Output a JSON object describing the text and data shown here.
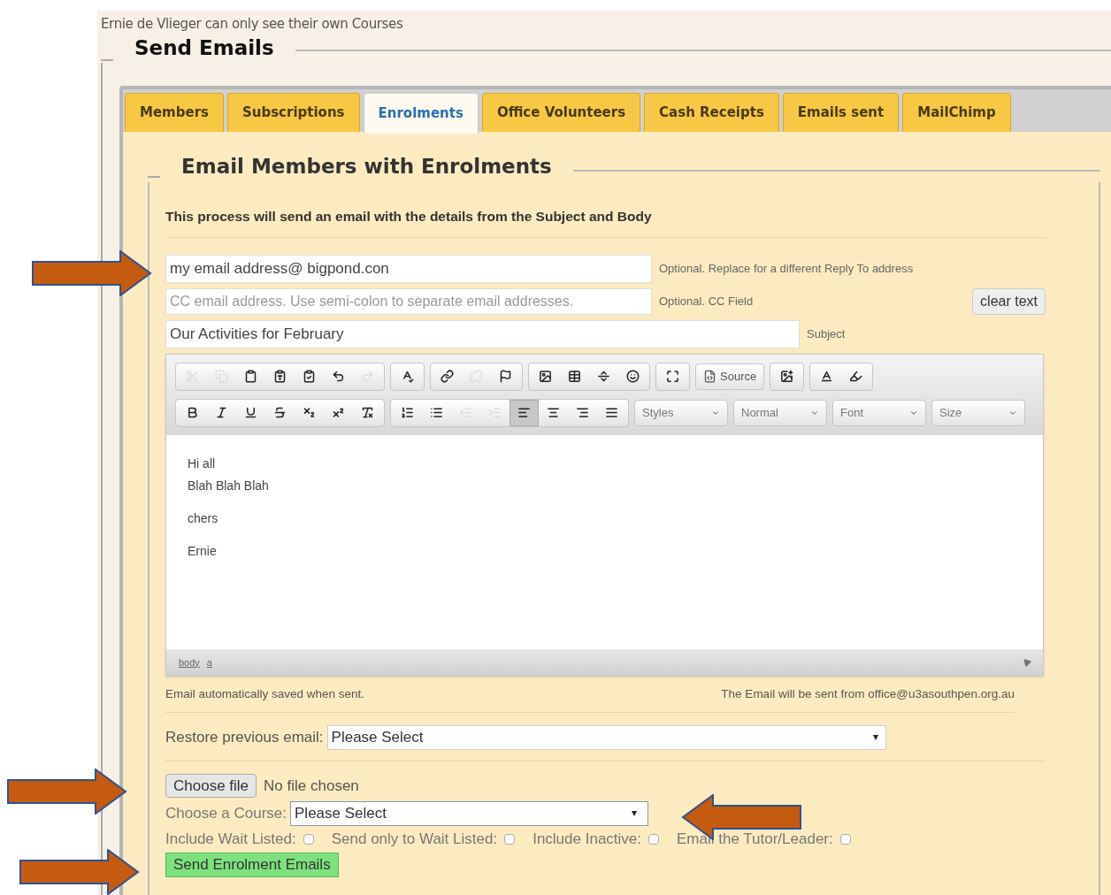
{
  "header": {
    "notice": "Ernie de Vlieger can only see their own Courses",
    "title": "Send Emails"
  },
  "tabs": [
    {
      "label": "Members",
      "selected": false
    },
    {
      "label": "Subscriptions",
      "selected": false
    },
    {
      "label": "Enrolments",
      "selected": true
    },
    {
      "label": "Office Volunteers",
      "selected": false
    },
    {
      "label": "Cash Receipts",
      "selected": false
    },
    {
      "label": "Emails sent",
      "selected": false
    },
    {
      "label": "MailChimp",
      "selected": false
    }
  ],
  "section": {
    "title": "Email Members with Enrolments",
    "intro": "This process will send an email with the details from the Subject and Body"
  },
  "reply_to": {
    "value": "my email address@ bigpond.con",
    "hint": "Optional. Replace for a different Reply To address"
  },
  "cc": {
    "placeholder": "CC email address. Use semi-colon to separate email addresses.",
    "hint": "Optional. CC Field",
    "clear_button": "clear text"
  },
  "subject": {
    "value": "Our Activities for February",
    "hint": "Subject"
  },
  "editor": {
    "toolbar_row_1": [
      [
        {
          "kind": "icon",
          "disabled": true
        },
        {
          "kind": "icon",
          "disabled": true
        },
        {
          "kind": "icon",
          "disabled": false
        },
        {
          "kind": "icon",
          "disabled": false
        },
        {
          "kind": "icon",
          "disabled": false
        },
        {
          "kind": "icon",
          "disabled": false
        },
        {
          "kind": "icon",
          "disabled": true
        }
      ],
      [
        {
          "kind": "icon",
          "disabled": false
        }
      ],
      [
        {
          "kind": "icon",
          "disabled": false
        },
        {
          "kind": "icon",
          "disabled": true
        },
        {
          "kind": "icon",
          "disabled": false
        }
      ],
      [
        {
          "kind": "icon",
          "disabled": false
        },
        {
          "kind": "icon",
          "disabled": false
        },
        {
          "kind": "icon",
          "disabled": false
        },
        {
          "kind": "icon",
          "disabled": false
        }
      ],
      [
        {
          "kind": "icon",
          "disabled": false
        }
      ],
      [
        {
          "kind": "text",
          "label": "Source"
        }
      ],
      [
        {
          "kind": "icon",
          "disabled": false
        }
      ],
      [
        {
          "kind": "icon",
          "disabled": false
        },
        {
          "kind": "icon",
          "disabled": false
        }
      ]
    ],
    "toolbar_row_2": [
      [
        {
          "kind": "icon",
          "disabled": false
        },
        {
          "kind": "icon",
          "disabled": false
        },
        {
          "kind": "icon",
          "disabled": false
        },
        {
          "kind": "icon",
          "disabled": false
        },
        {
          "kind": "icon",
          "disabled": false
        },
        {
          "kind": "icon",
          "disabled": false
        },
        {
          "kind": "icon",
          "disabled": false
        }
      ],
      [
        {
          "kind": "icon",
          "disabled": false
        },
        {
          "kind": "icon",
          "disabled": false
        },
        {
          "kind": "icon",
          "disabled": true
        },
        {
          "kind": "icon",
          "disabled": true
        },
        {
          "kind": "icon",
          "disabled": false,
          "selected": true
        },
        {
          "kind": "icon",
          "disabled": false,
          "selected": false
        },
        {
          "kind": "icon",
          "disabled": false,
          "selected": false
        },
        {
          "kind": "icon",
          "disabled": false,
          "selected": false
        }
      ],
      [
        {
          "kind": "dropdown",
          "label": "Styles"
        }
      ],
      [
        {
          "kind": "dropdown",
          "label": "Normal"
        }
      ],
      [
        {
          "kind": "dropdown",
          "label": "Font"
        }
      ],
      [
        {
          "kind": "dropdown",
          "label": "Size"
        }
      ]
    ],
    "body": [
      [
        "Hi all",
        "Blah Blah Blah"
      ],
      [
        "chers"
      ],
      [
        "Ernie"
      ]
    ],
    "path": [
      "body",
      "a"
    ]
  },
  "notes": {
    "saved": "Email automatically saved when sent.",
    "sender": "The Email will be sent from office@u3asouthpen.org.au"
  },
  "restore": {
    "label": "Restore previous email:",
    "value": "Please Select"
  },
  "file": {
    "button": "Choose file",
    "status": "No file chosen"
  },
  "course": {
    "label": "Choose a Course:",
    "value": "Please Select"
  },
  "options": [
    {
      "label": "Include Wait Listed:",
      "checked": false
    },
    {
      "label": "Send only to Wait Listed:",
      "checked": false
    },
    {
      "label": "Include Inactive:",
      "checked": false
    },
    {
      "label": "Email the Tutor/Leader:",
      "checked": false
    }
  ],
  "send_button": "Send Enrolment Emails"
}
